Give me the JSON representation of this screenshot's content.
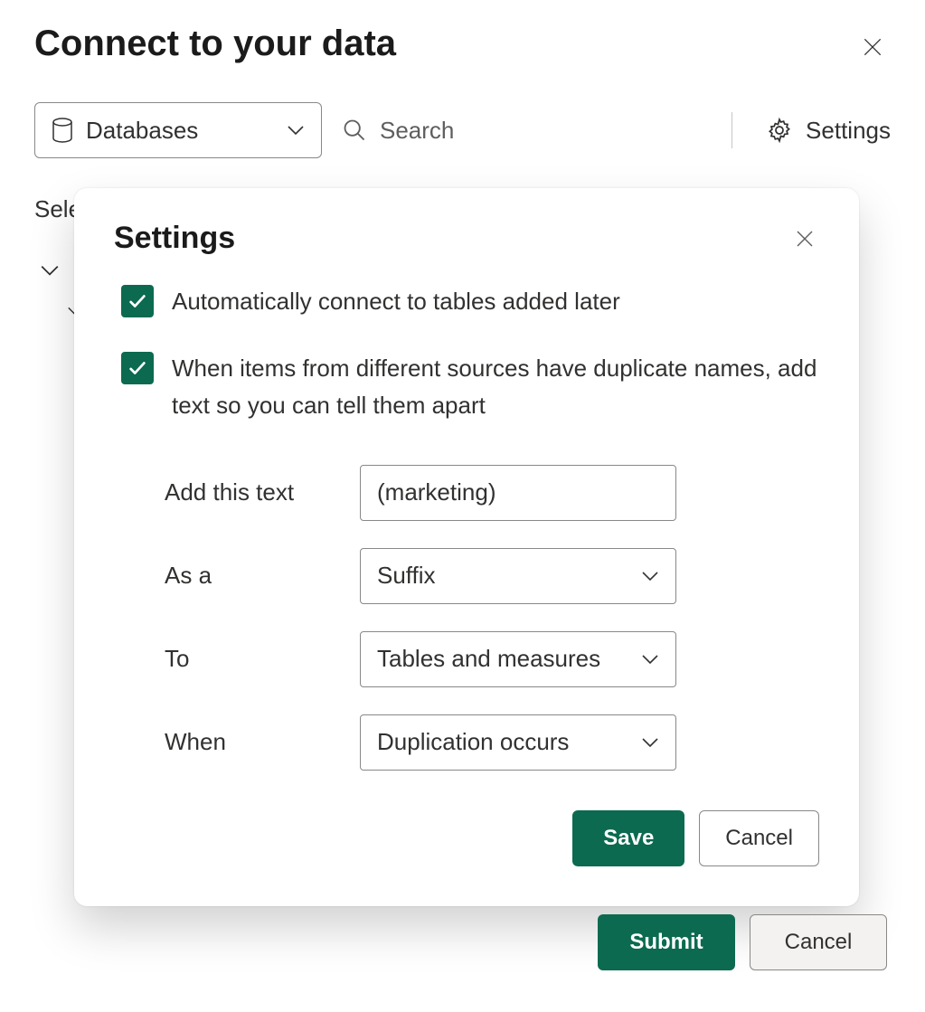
{
  "page": {
    "title": "Connect to your data",
    "datasource_label": "Databases",
    "search_placeholder": "Search",
    "settings_label": "Settings",
    "partial_text": "Sele",
    "submit_label": "Submit",
    "cancel_label": "Cancel"
  },
  "modal": {
    "title": "Settings",
    "checkbox1_label": "Automatically connect to tables added later",
    "checkbox2_label": "When items from different sources have duplicate names, add text so you can tell them apart",
    "form": {
      "add_text_label": "Add this text",
      "add_text_value": "(marketing)",
      "as_a_label": "As a",
      "as_a_value": "Suffix",
      "to_label": "To",
      "to_value": "Tables and measures",
      "when_label": "When",
      "when_value": "Duplication occurs"
    },
    "save_label": "Save",
    "cancel_label": "Cancel"
  }
}
